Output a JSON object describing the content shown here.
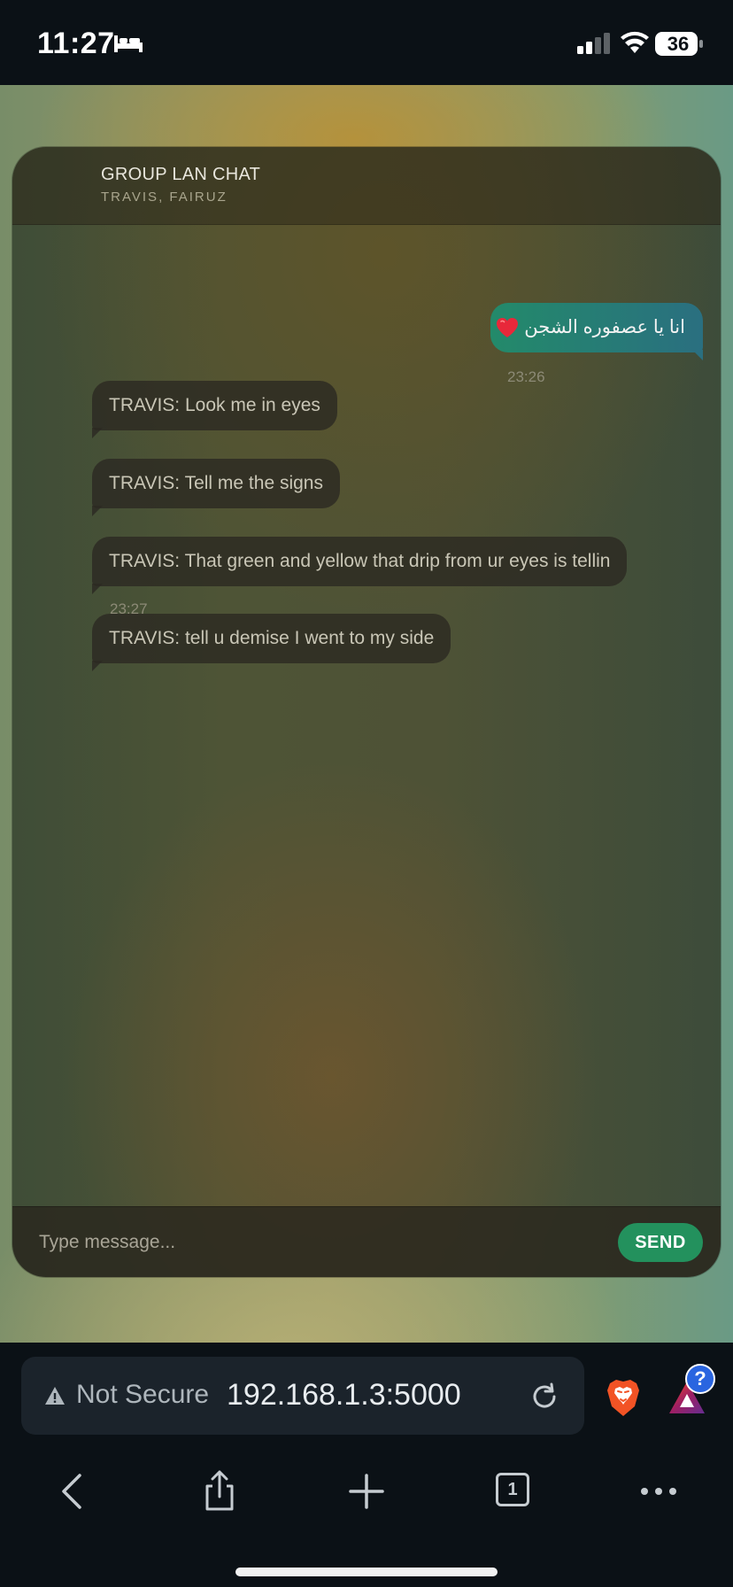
{
  "status_bar": {
    "time": "11:27",
    "battery": "36",
    "icons": [
      "bed-icon",
      "cellular-signal-icon",
      "wifi-icon",
      "battery-icon"
    ]
  },
  "chat": {
    "title": "GROUP LAN CHAT",
    "participants": "TRAVIS, FAIRUZ",
    "messages": [
      {
        "direction": "outgoing",
        "text": "انا يا عصفوره الشجن",
        "emoji": "heart-icon",
        "time": "23:26"
      },
      {
        "direction": "incoming",
        "text": "TRAVIS: Look me in eyes"
      },
      {
        "direction": "incoming",
        "text": "TRAVIS: Tell me the signs"
      },
      {
        "direction": "incoming",
        "text": "TRAVIS: That green and yellow that drip from ur eyes is tellin",
        "time": "23:27"
      },
      {
        "direction": "incoming",
        "text": "TRAVIS: tell u demise I went to my side"
      }
    ],
    "input": {
      "placeholder": "Type message...",
      "value": ""
    },
    "send_label": "SEND",
    "colors": {
      "outgoing_start": "#238a6a",
      "outgoing_end": "#2a6f80",
      "send_button": "#23915d"
    }
  },
  "browser": {
    "security_label": "Not Secure",
    "url": "192.168.1.3:5000",
    "tab_count": "1",
    "rewards_badge": "?",
    "toolbar": [
      "back-icon",
      "share-icon",
      "new-tab-icon",
      "tabs-icon",
      "more-icon"
    ]
  }
}
